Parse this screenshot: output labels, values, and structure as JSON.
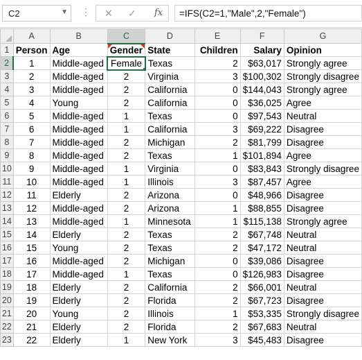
{
  "name_box": {
    "value": "C2",
    "dropdown_icon": "chevron-down-icon"
  },
  "formula_bar": {
    "cancel_glyph": "✕",
    "enter_glyph": "✓",
    "fx_label": "fx",
    "formula": "=IFS(C2=1,\"Male\",2,\"Female\")"
  },
  "columns": [
    "A",
    "B",
    "C",
    "D",
    "E",
    "F",
    "G"
  ],
  "header_row": [
    "Person",
    "Age",
    "Gender",
    "State",
    "Children",
    "Salary",
    "Opinion"
  ],
  "rows": [
    {
      "n": "2",
      "c": [
        "1",
        "Middle-aged",
        "Female",
        "Texas",
        "2",
        "$63,017",
        "Strongly agree"
      ]
    },
    {
      "n": "3",
      "c": [
        "2",
        "Middle-aged",
        "2",
        "Virginia",
        "3",
        "$100,302",
        "Strongly disagree"
      ]
    },
    {
      "n": "4",
      "c": [
        "3",
        "Middle-aged",
        "2",
        "California",
        "0",
        "$144,043",
        "Strongly agree"
      ]
    },
    {
      "n": "5",
      "c": [
        "4",
        "Young",
        "2",
        "California",
        "0",
        "$36,025",
        "Agree"
      ]
    },
    {
      "n": "6",
      "c": [
        "5",
        "Middle-aged",
        "1",
        "Texas",
        "0",
        "$97,543",
        "Neutral"
      ]
    },
    {
      "n": "7",
      "c": [
        "6",
        "Middle-aged",
        "1",
        "California",
        "3",
        "$69,222",
        "Disagree"
      ]
    },
    {
      "n": "8",
      "c": [
        "7",
        "Middle-aged",
        "2",
        "Michigan",
        "2",
        "$81,799",
        "Disagree"
      ]
    },
    {
      "n": "9",
      "c": [
        "8",
        "Middle-aged",
        "2",
        "Texas",
        "1",
        "$101,894",
        "Agree"
      ]
    },
    {
      "n": "10",
      "c": [
        "9",
        "Middle-aged",
        "1",
        "Virginia",
        "0",
        "$83,843",
        "Strongly disagree"
      ]
    },
    {
      "n": "11",
      "c": [
        "10",
        "Middle-aged",
        "1",
        "Illinois",
        "3",
        "$87,457",
        "Agree"
      ]
    },
    {
      "n": "12",
      "c": [
        "11",
        "Elderly",
        "2",
        "Arizona",
        "0",
        "$48,966",
        "Disagree"
      ]
    },
    {
      "n": "13",
      "c": [
        "12",
        "Middle-aged",
        "2",
        "Arizona",
        "1",
        "$88,855",
        "Disagree"
      ]
    },
    {
      "n": "14",
      "c": [
        "13",
        "Middle-aged",
        "1",
        "Minnesota",
        "1",
        "$115,138",
        "Strongly agree"
      ]
    },
    {
      "n": "15",
      "c": [
        "14",
        "Elderly",
        "2",
        "Texas",
        "2",
        "$67,748",
        "Neutral"
      ]
    },
    {
      "n": "16",
      "c": [
        "15",
        "Young",
        "2",
        "Texas",
        "2",
        "$47,172",
        "Neutral"
      ]
    },
    {
      "n": "17",
      "c": [
        "16",
        "Middle-aged",
        "2",
        "Michigan",
        "0",
        "$39,086",
        "Disagree"
      ]
    },
    {
      "n": "18",
      "c": [
        "17",
        "Middle-aged",
        "1",
        "Texas",
        "0",
        "$126,983",
        "Disagree"
      ]
    },
    {
      "n": "19",
      "c": [
        "18",
        "Elderly",
        "2",
        "California",
        "2",
        "$66,001",
        "Neutral"
      ]
    },
    {
      "n": "20",
      "c": [
        "19",
        "Elderly",
        "2",
        "Florida",
        "2",
        "$67,723",
        "Disagree"
      ]
    },
    {
      "n": "21",
      "c": [
        "20",
        "Young",
        "2",
        "Illinois",
        "1",
        "$53,335",
        "Strongly disagree"
      ]
    },
    {
      "n": "22",
      "c": [
        "21",
        "Elderly",
        "2",
        "Florida",
        "2",
        "$67,683",
        "Neutral"
      ]
    },
    {
      "n": "23",
      "c": [
        "22",
        "Elderly",
        "1",
        "New York",
        "3",
        "$45,483",
        "Disagree"
      ]
    }
  ],
  "selection": {
    "cell": "C2",
    "accent": "#217346",
    "comment_marker": "#e0301e"
  }
}
